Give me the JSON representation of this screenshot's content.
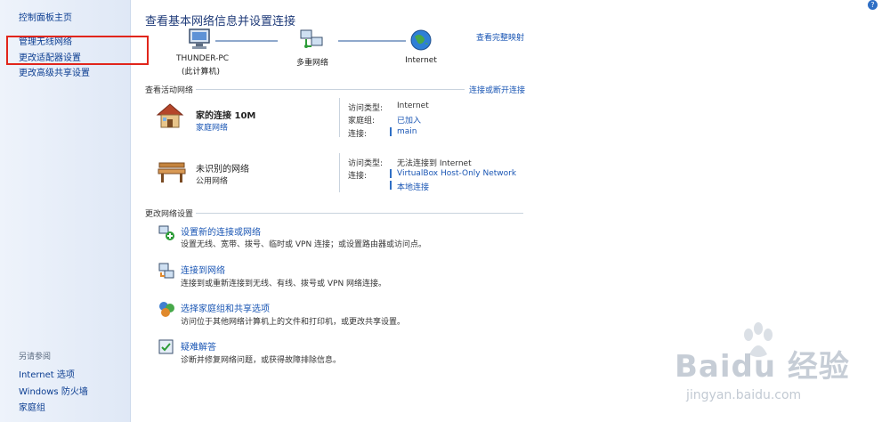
{
  "sidebar": {
    "home": "控制面板主页",
    "manage_wireless": "管理无线网络",
    "change_adapter": "更改适配器设置",
    "change_sharing": "更改高级共享设置",
    "see_also": "另请参阅",
    "internet_options": "Internet 选项",
    "firewall": "Windows 防火墙",
    "homegroup": "家庭组"
  },
  "main": {
    "title": "查看基本网络信息并设置连接",
    "view_full_map": "查看完整映射",
    "map": {
      "pc_name": "THUNDER-PC",
      "pc_sub": "(此计算机)",
      "network": "多重网络",
      "internet": "Internet"
    },
    "active_networks_label": "查看活动网络",
    "connect_disconnect": "连接或断开连接",
    "networks": [
      {
        "name": "家的连接 10M",
        "type": "家庭网络",
        "access_label": "访问类型:",
        "access_value": "Internet",
        "homegroup_label": "家庭组:",
        "homegroup_value": "已加入",
        "conn_label": "连接:",
        "conn_value": "main"
      },
      {
        "name": "未识别的网络",
        "type": "公用网络",
        "access_label": "访问类型:",
        "access_value": "无法连接到 Internet",
        "conn_label": "连接:",
        "conn_value_1": "VirtualBox Host-Only Network",
        "conn_value_2": "本地连接"
      }
    ],
    "change_settings_label": "更改网络设置",
    "tasks": [
      {
        "title": "设置新的连接或网络",
        "desc": "设置无线、宽带、拨号、临时或 VPN 连接；或设置路由器或访问点。"
      },
      {
        "title": "连接到网络",
        "desc": "连接到或重新连接到无线、有线、拨号或 VPN 网络连接。"
      },
      {
        "title": "选择家庭组和共享选项",
        "desc": "访问位于其他网络计算机上的文件和打印机，或更改共享设置。"
      },
      {
        "title": "疑难解答",
        "desc": "诊断并修复网络问题，或获得故障排除信息。"
      }
    ]
  },
  "watermark": {
    "brand": "Baidu 经验",
    "url": "jingyan.baidu.com"
  },
  "colors": {
    "link": "#1a56b4",
    "highlight_box": "#e1251b",
    "sidebar_bg": "#e4ecf7"
  }
}
